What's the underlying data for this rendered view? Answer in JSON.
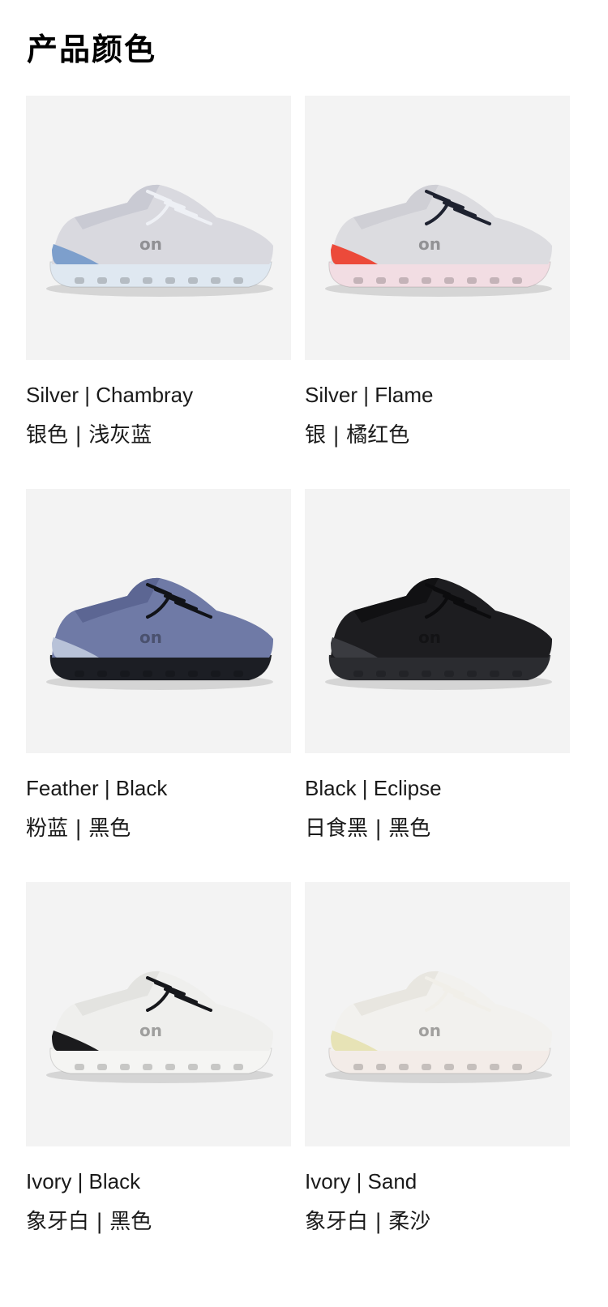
{
  "page": {
    "title": "产品颜色"
  },
  "colors": [
    {
      "name_en": "Silver | Chambray",
      "name_cn": "银色 | 浅灰蓝",
      "icon": "shoe-image",
      "palette": {
        "upper": "#d9d9df",
        "collar": "#c9cad3",
        "sole": "#dfe8f1",
        "accent": "#7d9fcc",
        "lace": "#eef0f5"
      }
    },
    {
      "name_en": "Silver | Flame",
      "name_cn": "银 | 橘红色",
      "icon": "shoe-image",
      "palette": {
        "upper": "#dcdce0",
        "collar": "#cfcfd5",
        "sole": "#f2dde3",
        "accent": "#ec4a3a",
        "lace": "#1e2230"
      }
    },
    {
      "name_en": "Feather | Black",
      "name_cn": "粉蓝 | 黑色",
      "icon": "shoe-image",
      "palette": {
        "upper": "#6f7aa6",
        "collar": "#5c6693",
        "sole": "#1c1e24",
        "accent": "#b8c2d8",
        "lace": "#111318"
      }
    },
    {
      "name_en": "Black | Eclipse",
      "name_cn": "日食黑 | 黑色",
      "icon": "shoe-image",
      "palette": {
        "upper": "#1d1d20",
        "collar": "#111113",
        "sole": "#2b2c30",
        "accent": "#3a3b40",
        "lace": "#0c0c0e"
      }
    },
    {
      "name_en": "Ivory | Black",
      "name_cn": "象牙白 | 黑色",
      "icon": "shoe-image",
      "palette": {
        "upper": "#efefed",
        "collar": "#e3e3e0",
        "sole": "#f5f5f3",
        "accent": "#1b1b1d",
        "lace": "#17181c"
      }
    },
    {
      "name_en": "Ivory | Sand",
      "name_cn": "象牙白 | 柔沙",
      "icon": "shoe-image",
      "palette": {
        "upper": "#f2f1ee",
        "collar": "#e8e6e0",
        "sole": "#f3ece8",
        "accent": "#e7e3b6",
        "lace": "#f1efe9"
      }
    }
  ]
}
